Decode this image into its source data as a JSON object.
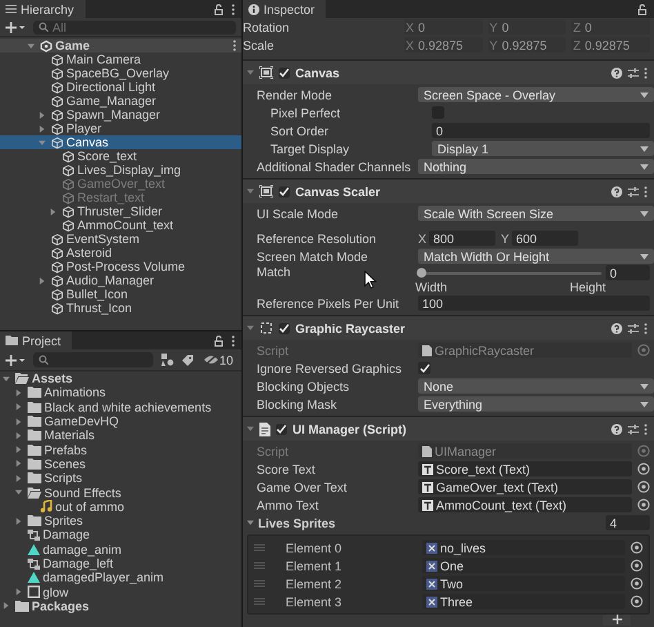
{
  "hierarchy": {
    "title": "Hierarchy",
    "search": {
      "placeholder": "All"
    },
    "items": [
      {
        "name": "Game",
        "kind": "scene",
        "expanded": true,
        "selected": false,
        "disabled": false,
        "children": [
          {
            "name": "Main Camera",
            "kind": "object",
            "selected": false,
            "disabled": false
          },
          {
            "name": "SpaceBG_Overlay",
            "kind": "object",
            "selected": false,
            "disabled": false
          },
          {
            "name": "Directional Light",
            "kind": "object",
            "selected": false,
            "disabled": false
          },
          {
            "name": "Game_Manager",
            "kind": "object",
            "selected": false,
            "disabled": false
          },
          {
            "name": "Spawn_Manager",
            "kind": "object",
            "expanded": false,
            "selected": false,
            "disabled": false
          },
          {
            "name": "Player",
            "kind": "object",
            "expanded": false,
            "selected": false,
            "disabled": false
          },
          {
            "name": "Canvas",
            "kind": "object",
            "expanded": true,
            "selected": true,
            "disabled": false,
            "children": [
              {
                "name": "Score_text",
                "kind": "object",
                "selected": false,
                "disabled": false
              },
              {
                "name": "Lives_Display_img",
                "kind": "object",
                "selected": false,
                "disabled": false
              },
              {
                "name": "GameOver_text",
                "kind": "object",
                "selected": false,
                "disabled": true
              },
              {
                "name": "Restart_text",
                "kind": "object",
                "selected": false,
                "disabled": true
              },
              {
                "name": "Thruster_Slider",
                "kind": "object",
                "expanded": false,
                "selected": false,
                "disabled": false
              },
              {
                "name": "AmmoCount_text",
                "kind": "object",
                "selected": false,
                "disabled": false
              }
            ]
          },
          {
            "name": "EventSystem",
            "kind": "object",
            "selected": false,
            "disabled": false
          },
          {
            "name": "Asteroid",
            "kind": "object",
            "selected": false,
            "disabled": false
          },
          {
            "name": "Post-Process Volume",
            "kind": "object",
            "selected": false,
            "disabled": false
          },
          {
            "name": "Audio_Manager",
            "kind": "object",
            "expanded": false,
            "selected": false,
            "disabled": false
          },
          {
            "name": "Bullet_Icon",
            "kind": "object",
            "selected": false,
            "disabled": false
          },
          {
            "name": "Thrust_Icon",
            "kind": "object",
            "selected": false,
            "disabled": false
          }
        ]
      }
    ]
  },
  "project": {
    "title": "Project",
    "hidden_count": "10",
    "items": [
      {
        "name": "Assets",
        "kind": "folder",
        "expanded": true,
        "children": [
          {
            "name": "Animations",
            "kind": "folder",
            "expanded": false
          },
          {
            "name": "Black and white achievements",
            "kind": "folder",
            "expanded": false
          },
          {
            "name": "GameDevHQ",
            "kind": "folder",
            "expanded": false
          },
          {
            "name": "Materials",
            "kind": "folder",
            "expanded": false
          },
          {
            "name": "Prefabs",
            "kind": "folder",
            "expanded": false
          },
          {
            "name": "Scenes",
            "kind": "folder",
            "expanded": false
          },
          {
            "name": "Scripts",
            "kind": "folder",
            "expanded": false
          },
          {
            "name": "Sound Effects",
            "kind": "folder",
            "expanded": true,
            "children": [
              {
                "name": "out of ammo",
                "kind": "audio"
              }
            ]
          },
          {
            "name": "Sprites",
            "kind": "folder",
            "expanded": false
          },
          {
            "name": "Damage",
            "kind": "animator"
          },
          {
            "name": "damage_anim",
            "kind": "animation"
          },
          {
            "name": "Damage_left",
            "kind": "animator"
          },
          {
            "name": "damagedPlayer_anim",
            "kind": "animation"
          },
          {
            "name": "glow",
            "kind": "material",
            "expanded": false
          }
        ]
      },
      {
        "name": "Packages",
        "kind": "folder",
        "expanded": false
      }
    ]
  },
  "inspector": {
    "title": "Inspector",
    "transform_rows": [
      {
        "label": "Rotation",
        "axes": [
          {
            "axis": "X",
            "value": "0"
          },
          {
            "axis": "Y",
            "value": "0"
          },
          {
            "axis": "Z",
            "value": "0"
          }
        ]
      },
      {
        "label": "Scale",
        "axes": [
          {
            "axis": "X",
            "value": "0.92875"
          },
          {
            "axis": "Y",
            "value": "0.92875"
          },
          {
            "axis": "Z",
            "value": "0.92875"
          }
        ]
      }
    ],
    "components": [
      {
        "title": "Canvas",
        "kind": "canvas",
        "enabled": true,
        "expanded": true,
        "properties": [
          {
            "kind": "dropdown",
            "label": "Render Mode",
            "value": "Screen Space - Overlay",
            "children": [
              {
                "kind": "checkbox",
                "label": "Pixel Perfect",
                "checked": false
              },
              {
                "kind": "number",
                "label": "Sort Order",
                "value": "0"
              },
              {
                "kind": "dropdown",
                "label": "Target Display",
                "value": "Display 1"
              }
            ]
          },
          {
            "kind": "dropdown",
            "label": "Additional Shader Channels",
            "value": "Nothing"
          }
        ]
      },
      {
        "title": "Canvas Scaler",
        "kind": "canvas",
        "enabled": true,
        "expanded": true,
        "properties": [
          {
            "kind": "dropdown",
            "label": "UI Scale Mode",
            "value": "Scale With Screen Size"
          },
          {
            "kind": "vector2",
            "label": "Reference Resolution",
            "axes": [
              {
                "axis": "X",
                "value": "800"
              },
              {
                "axis": "Y",
                "value": "600"
              }
            ]
          },
          {
            "kind": "dropdown",
            "label": "Screen Match Mode",
            "value": "Match Width Or Height"
          },
          {
            "kind": "slider",
            "label": "Match",
            "level": 0,
            "value": "0",
            "min_label": "Width",
            "max_label": "Height"
          },
          {
            "kind": "number",
            "label": "Reference Pixels Per Unit",
            "value": "100"
          }
        ]
      },
      {
        "title": "Graphic Raycaster",
        "kind": "raycaster",
        "enabled": true,
        "expanded": true,
        "properties": [
          {
            "kind": "script_object",
            "label": "Script",
            "value": "GraphicRaycaster",
            "disabled": true
          },
          {
            "kind": "checkbox",
            "label": "Ignore Reversed Graphics",
            "checked": true
          },
          {
            "kind": "dropdown",
            "label": "Blocking Objects",
            "value": "None"
          },
          {
            "kind": "dropdown",
            "label": "Blocking Mask",
            "value": "Everything"
          }
        ]
      },
      {
        "title": "UI Manager (Script)",
        "kind": "script",
        "enabled": true,
        "expanded": true,
        "properties": [
          {
            "kind": "script_object",
            "label": "Script",
            "value": "UIManager",
            "disabled": true
          },
          {
            "kind": "text_object",
            "label": "Score Text",
            "value": "Score_text (Text)",
            "disabled": false
          },
          {
            "kind": "text_object",
            "label": "Game Over Text",
            "value": "GameOver_text (Text)",
            "disabled": false
          },
          {
            "kind": "text_object",
            "label": "Ammo Text",
            "value": "AmmoCount_text (Text)",
            "disabled": false
          },
          {
            "kind": "array",
            "label": "Lives Sprites",
            "size": "4",
            "expanded": true,
            "elements": [
              {
                "label": "Element 0",
                "value": "no_lives",
                "kind": "sprite"
              },
              {
                "label": "Element 1",
                "value": "One",
                "kind": "sprite"
              },
              {
                "label": "Element 2",
                "value": "Two",
                "kind": "sprite"
              },
              {
                "label": "Element 3",
                "value": "Three",
                "kind": "sprite"
              }
            ]
          }
        ]
      }
    ]
  }
}
